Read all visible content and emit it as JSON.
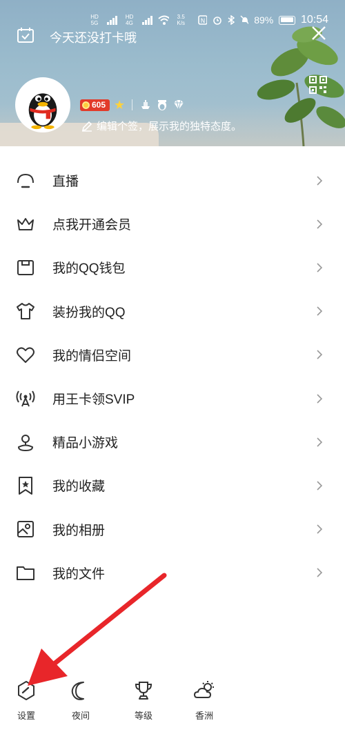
{
  "status_bar": {
    "network_1": "HD 5G",
    "network_2": "HD 4G",
    "speed": "3.5 K/s",
    "battery": "89%",
    "time": "10:54"
  },
  "header": {
    "checkin_text": "今天还没打卡哦",
    "level_value": "605",
    "signature": "编辑个签，展示我的独特态度。"
  },
  "menu": {
    "items": [
      {
        "label": "直播",
        "icon": "live-icon"
      },
      {
        "label": "点我开通会员",
        "icon": "crown-icon"
      },
      {
        "label": "我的QQ钱包",
        "icon": "wallet-icon"
      },
      {
        "label": "装扮我的QQ",
        "icon": "tshirt-icon"
      },
      {
        "label": "我的情侣空间",
        "icon": "heart-icon"
      },
      {
        "label": "用王卡领SVIP",
        "icon": "signal-tower-icon"
      },
      {
        "label": "精品小游戏",
        "icon": "game-icon"
      },
      {
        "label": "我的收藏",
        "icon": "bookmark-icon"
      },
      {
        "label": "我的相册",
        "icon": "album-icon"
      },
      {
        "label": "我的文件",
        "icon": "folder-icon"
      }
    ]
  },
  "bottom_bar": {
    "settings": "设置",
    "night": "夜间",
    "level": "等级",
    "weather": "香洲"
  }
}
